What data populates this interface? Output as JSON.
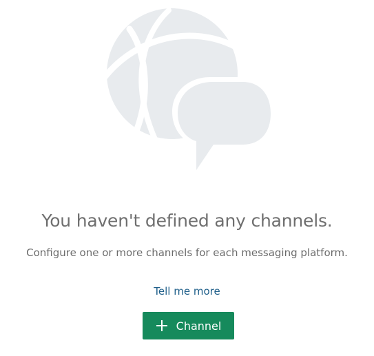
{
  "empty_state": {
    "illustration_icon": "globe-chat-bubble-icon",
    "title": "You haven't defined any channels.",
    "subtitle": "Configure one or more channels for each messaging platform.",
    "link_label": "Tell me more",
    "add_button_label": "Channel",
    "add_button_icon": "plus-icon"
  },
  "colors": {
    "illustration": "#e8ebee",
    "title": "#6f6f6f",
    "link": "#1f5f8a",
    "button_bg": "#168a5c",
    "button_text": "#ffffff"
  }
}
